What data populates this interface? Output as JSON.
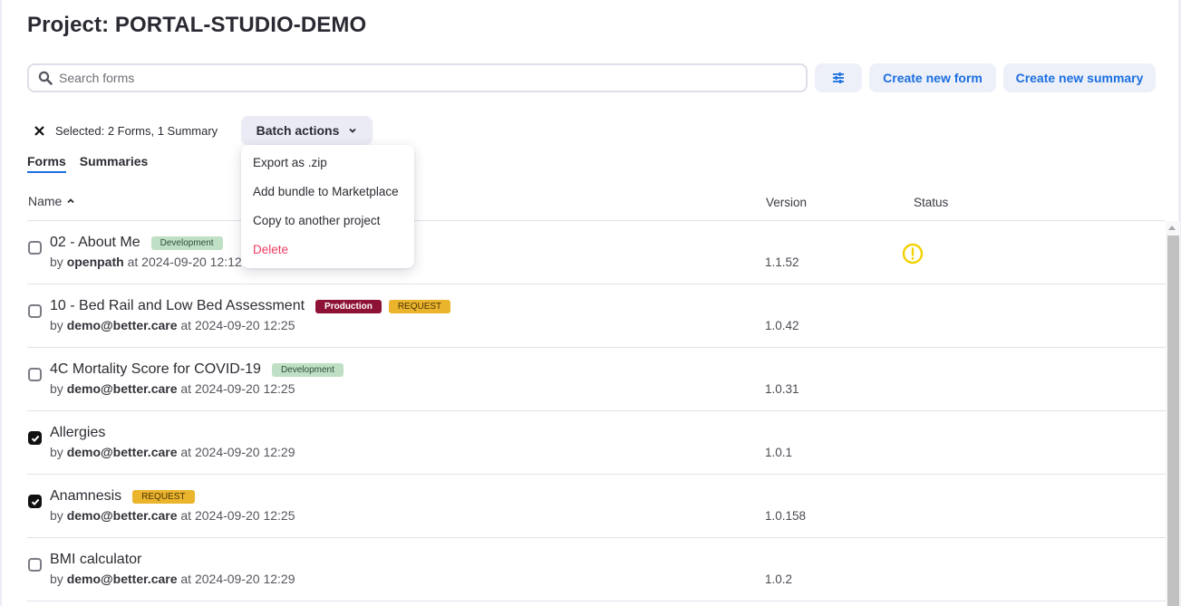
{
  "header": {
    "title": "Project: PORTAL-STUDIO-DEMO"
  },
  "search": {
    "placeholder": "Search forms",
    "value": ""
  },
  "toolbar": {
    "filter_icon": "sliders-icon",
    "create_form_label": "Create new form",
    "create_summary_label": "Create new summary"
  },
  "selection": {
    "clear_icon": "close-icon",
    "text": "Selected: 2 Forms, 1 Summary",
    "batch_label": "Batch actions",
    "batch_menu": [
      {
        "label": "Export as .zip"
      },
      {
        "label": "Add bundle to Marketplace"
      },
      {
        "label": "Copy to another project"
      },
      {
        "label": "Delete",
        "danger": true
      }
    ]
  },
  "tabs": [
    {
      "label": "Forms",
      "active": true
    },
    {
      "label": "Summaries",
      "active": false
    }
  ],
  "table": {
    "columns": {
      "name": "Name",
      "version": "Version",
      "status": "Status"
    },
    "sort": {
      "column": "name",
      "direction": "asc"
    },
    "rows": [
      {
        "name": "02 - About Me",
        "badges": [
          {
            "label": "Development",
            "type": "dev"
          }
        ],
        "by_prefix": "by",
        "author": "openpath",
        "at_prefix": "at",
        "date": "2024-09-20 12:12",
        "version": "1.1.52",
        "status": "warning",
        "checked": false
      },
      {
        "name": "10 - Bed Rail and Low Bed Assessment",
        "badges": [
          {
            "label": "Production",
            "type": "prod"
          },
          {
            "label": "REQUEST",
            "type": "req"
          }
        ],
        "by_prefix": "by",
        "author": "demo@better.care",
        "at_prefix": "at",
        "date": "2024-09-20 12:25",
        "version": "1.0.42",
        "status": "",
        "checked": false
      },
      {
        "name": "4C Mortality Score for COVID-19",
        "badges": [
          {
            "label": "Development",
            "type": "dev"
          }
        ],
        "by_prefix": "by",
        "author": "demo@better.care",
        "at_prefix": "at",
        "date": "2024-09-20 12:25",
        "version": "1.0.31",
        "status": "",
        "checked": false
      },
      {
        "name": "Allergies",
        "badges": [],
        "by_prefix": "by",
        "author": "demo@better.care",
        "at_prefix": "at",
        "date": "2024-09-20 12:29",
        "version": "1.0.1",
        "status": "",
        "checked": true
      },
      {
        "name": "Anamnesis",
        "badges": [
          {
            "label": "REQUEST",
            "type": "req"
          }
        ],
        "by_prefix": "by",
        "author": "demo@better.care",
        "at_prefix": "at",
        "date": "2024-09-20 12:25",
        "version": "1.0.158",
        "status": "",
        "checked": true
      },
      {
        "name": "BMI calculator",
        "badges": [],
        "by_prefix": "by",
        "author": "demo@better.care",
        "at_prefix": "at",
        "date": "2024-09-20 12:29",
        "version": "1.0.2",
        "status": "",
        "checked": false
      }
    ]
  },
  "colors": {
    "accent": "#1a6fe0",
    "danger": "#ef3d62",
    "warning": "#f2d100",
    "badge_development": "#bfe0c4",
    "badge_production": "#8e1236",
    "badge_request": "#ebb42d"
  }
}
